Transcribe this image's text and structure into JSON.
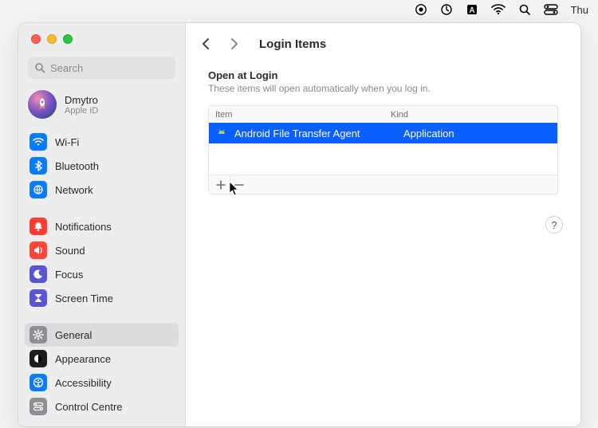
{
  "menubar": {
    "day": "Thu"
  },
  "window": {
    "search_placeholder": "Search",
    "profile": {
      "name": "Dmytro",
      "sub": "Apple ID"
    },
    "sidebar_groups": [
      [
        {
          "id": "wifi",
          "label": "Wi-Fi",
          "color": "blue",
          "icon": "wifi"
        },
        {
          "id": "bluetooth",
          "label": "Bluetooth",
          "color": "blue",
          "icon": "bluetooth"
        },
        {
          "id": "network",
          "label": "Network",
          "color": "blue",
          "icon": "globe"
        }
      ],
      [
        {
          "id": "notifications",
          "label": "Notifications",
          "color": "red",
          "icon": "bell"
        },
        {
          "id": "sound",
          "label": "Sound",
          "color": "pink",
          "icon": "speaker"
        },
        {
          "id": "focus",
          "label": "Focus",
          "color": "purple",
          "icon": "moon"
        },
        {
          "id": "screentime",
          "label": "Screen Time",
          "color": "purple",
          "icon": "hourglass"
        }
      ],
      [
        {
          "id": "general",
          "label": "General",
          "color": "gray",
          "icon": "gear",
          "selected": true
        },
        {
          "id": "appearance",
          "label": "Appearance",
          "color": "black",
          "icon": "appearance"
        },
        {
          "id": "accessibility",
          "label": "Accessibility",
          "color": "blue",
          "icon": "accessibility"
        },
        {
          "id": "controlcentre",
          "label": "Control Centre",
          "color": "gray",
          "icon": "switches"
        }
      ]
    ],
    "content": {
      "nav_back_enabled": true,
      "nav_forward_enabled": false,
      "title": "Login Items",
      "section_title": "Open at Login",
      "section_sub": "These items will open automatically when you log in.",
      "columns": {
        "item": "Item",
        "kind": "Kind"
      },
      "rows": [
        {
          "name": "Android File Transfer Agent",
          "kind": "Application",
          "selected": true
        }
      ],
      "help_symbol": "?"
    }
  },
  "colors": {
    "selection": "#0a60ff"
  }
}
